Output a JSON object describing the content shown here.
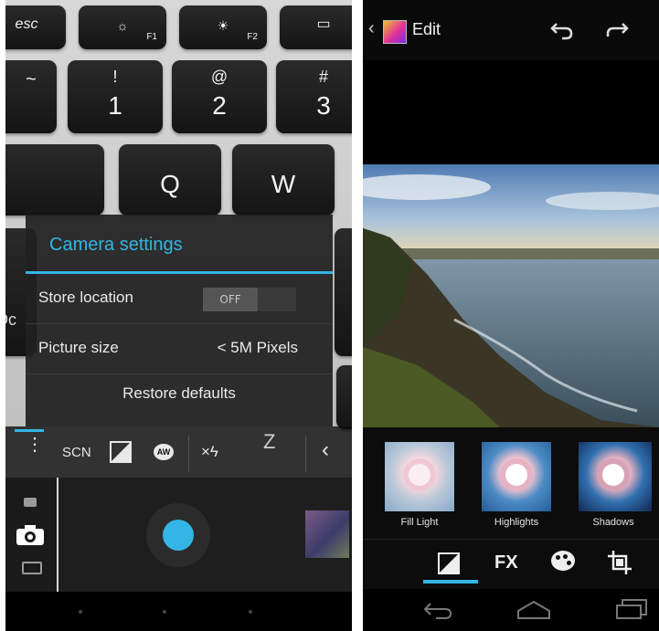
{
  "keyboard": {
    "esc": "esc",
    "f1": "F1",
    "f2": "F2",
    "one": {
      "top": "!",
      "bottom": "1"
    },
    "two": {
      "top": "@",
      "bottom": "2"
    },
    "three": {
      "top": "#",
      "bottom": "3"
    },
    "q": "Q",
    "w": "W",
    "tilde": "~",
    "partial_left": "Dc",
    "z": "Z"
  },
  "camera_settings": {
    "title": "Camera settings",
    "store_location_label": "Store location",
    "store_location_value": "OFF",
    "picture_size_label": "Picture size",
    "picture_size_value": "< 5M Pixels",
    "restore_defaults": "Restore defaults"
  },
  "camera_toolbar": {
    "scene_label": "SCN",
    "white_balance_label": "AW",
    "flash_label": "×ϟ"
  },
  "editor": {
    "title": "Edit",
    "back_chevron": "‹"
  },
  "filters": [
    {
      "label": "Fill Light"
    },
    {
      "label": "Highlights"
    },
    {
      "label": "Shadows"
    }
  ],
  "tools": {
    "fx_label": "FX"
  },
  "colors": {
    "accent": "#33b5e5",
    "dialog_bg": "#202020",
    "bar_bg": "#0c0c0c"
  },
  "icons": [
    "menu-dots-icon",
    "exposure-icon",
    "video-camera-icon",
    "camera-icon",
    "panorama-icon",
    "undo-icon",
    "redo-icon",
    "palette-icon",
    "crop-icon",
    "nav-back-icon",
    "nav-home-icon",
    "nav-recents-icon"
  ]
}
